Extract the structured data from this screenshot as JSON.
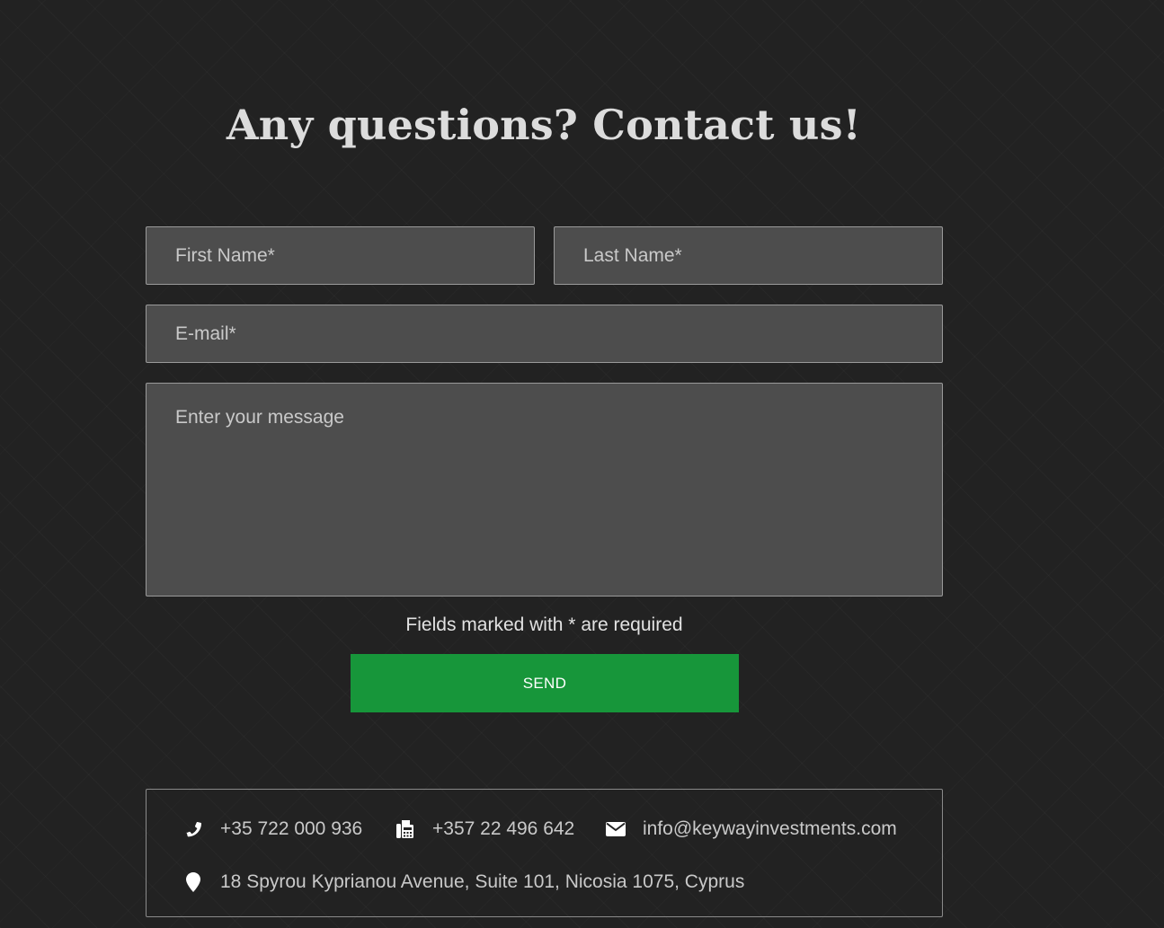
{
  "heading": "Any questions? Contact us!",
  "form": {
    "first_name_placeholder": "First Name*",
    "last_name_placeholder": "Last Name*",
    "email_placeholder": "E-mail*",
    "message_placeholder": "Enter your message",
    "required_note": "Fields marked with * are required",
    "send_label": "SEND"
  },
  "contact": {
    "phone": "+35 722 000 936",
    "fax": "+357 22 496 642",
    "email": "info@keywayinvestments.com",
    "address": "18 Spyrou Kyprianou Avenue, Suite 101, Nicosia 1075, Cyprus",
    "icons": {
      "phone": "phone-icon",
      "fax": "fax-icon",
      "email": "envelope-icon",
      "address": "map-marker-icon"
    }
  },
  "colors": {
    "background": "#222222",
    "field_background": "#4d4d4d",
    "send_button": "#17963a"
  }
}
